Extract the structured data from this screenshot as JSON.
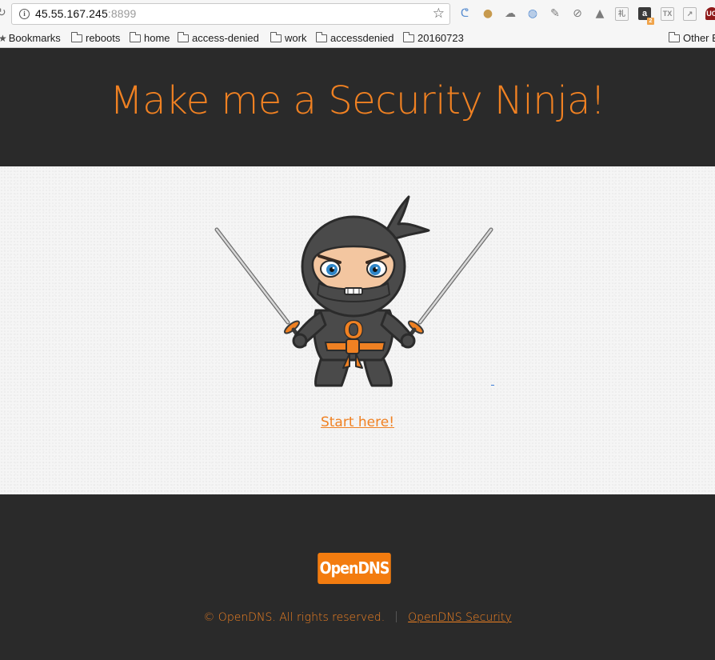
{
  "browser": {
    "url_host": "45.55.167.245",
    "url_port": ":8899",
    "extensions": [
      "jquery-icon",
      "cookie-icon",
      "cloud-icon",
      "globe-icon",
      "feather-icon",
      "compass-icon",
      "warning-icon",
      "note-icon",
      "amazon-icon",
      "tex-icon",
      "image-icon",
      "ublock-icon"
    ],
    "amazon_letter": "a",
    "amazon_badge": "2",
    "tex_text": "TX",
    "ublock_text": "UO",
    "note_text": "礼"
  },
  "bookmarks_bar": {
    "bookmarks_label": "Bookmarks",
    "folders": [
      "reboots",
      "home",
      "access-denied",
      "work",
      "accessdenied",
      "20160723"
    ],
    "other_label": "Other B"
  },
  "header": {
    "title": "Make me a Security Ninja!"
  },
  "main": {
    "mascot_letter": "O",
    "start_link": "Start here!"
  },
  "footer": {
    "logo_text": "OpenDNS",
    "copyright": "© OpenDNS. All rights reserved.",
    "security_link": "OpenDNS Security"
  },
  "colors": {
    "accent": "#f08122",
    "dark_bg": "#2a2a2a",
    "page_bg": "#f5f5f5",
    "logo_bg": "#f37c0f"
  }
}
